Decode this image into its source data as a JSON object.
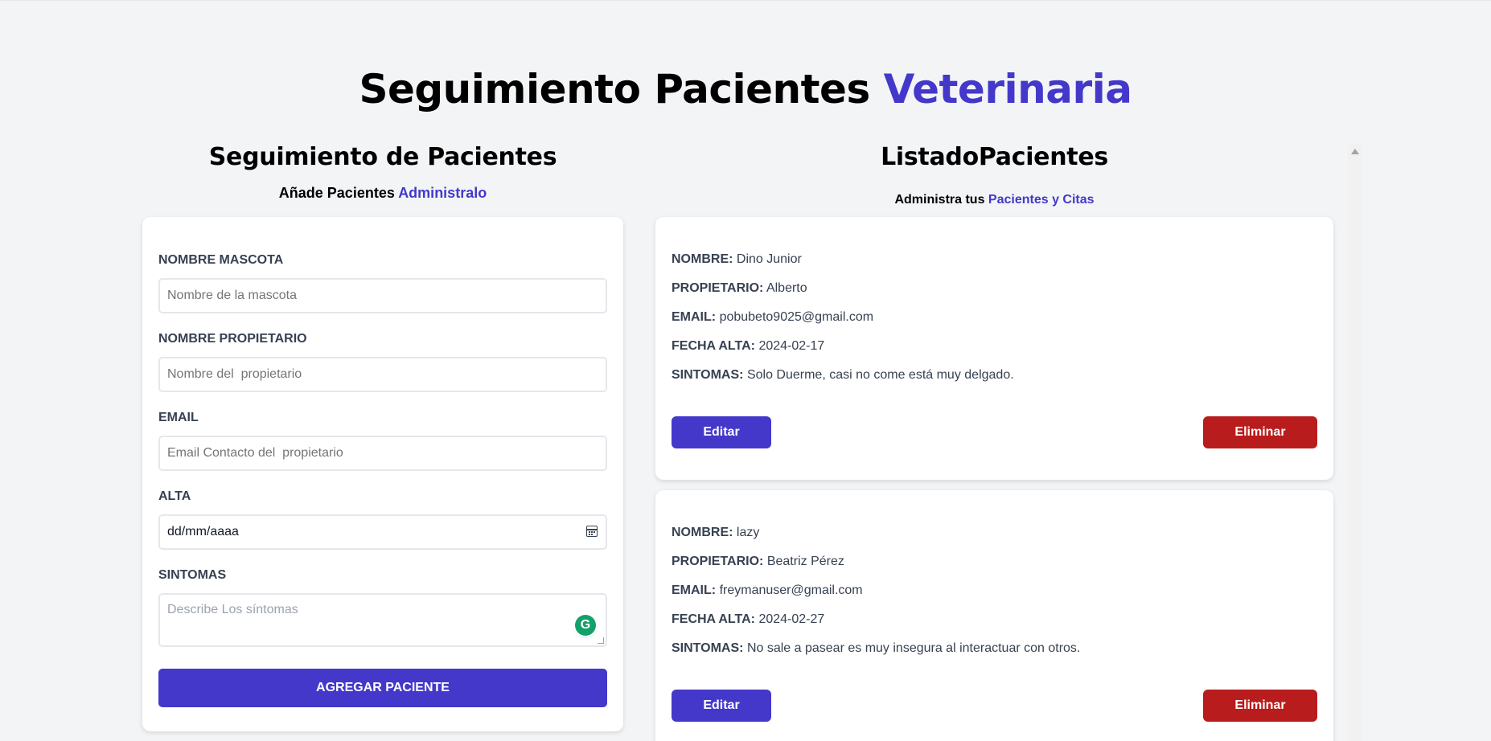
{
  "header": {
    "title_main": "Seguimiento Pacientes",
    "title_accent": "Veterinaria"
  },
  "form_section": {
    "title": "Seguimiento de Pacientes",
    "subtitle_main": "Añade Pacientes",
    "subtitle_accent": "Administralo",
    "fields": {
      "pet_name": {
        "label": "Nombre Mascota",
        "placeholder": "Nombre de la mascota"
      },
      "owner_name": {
        "label": "Nombre Propietario",
        "placeholder": "Nombre del  propietario"
      },
      "email": {
        "label": "Email",
        "placeholder": "Email Contacto del  propietario"
      },
      "discharge": {
        "label": "Alta",
        "value": "dd/mm/aaaa"
      },
      "symptoms": {
        "label": "Sintomas",
        "placeholder": "Describe Los síntomas"
      }
    },
    "submit_label": "Agregar Paciente"
  },
  "list_section": {
    "title": "ListadoPacientes",
    "subtitle_main": "Administra tus",
    "subtitle_accent": "Pacientes y Citas",
    "field_labels": {
      "name": "NOMBRE:",
      "owner": "PROPIETARIO:",
      "email": "EMAIL:",
      "date": "FECHA ALTA:",
      "symptoms": "SINTOMAS:"
    },
    "edit_label": "Editar",
    "delete_label": "Eliminar",
    "patients": [
      {
        "name": "Dino Junior",
        "owner": "Alberto",
        "email": "pobubeto9025@gmail.com",
        "date": "2024-02-17",
        "symptoms": "Solo Duerme, casi no come está muy delgado."
      },
      {
        "name": "lazy",
        "owner": "Beatriz Pérez",
        "email": "freymanuser@gmail.com",
        "date": "2024-02-27",
        "symptoms": "No sale a pasear es muy insegura al interactuar con otros."
      }
    ]
  },
  "colors": {
    "accent": "#4338ca",
    "danger": "#b91c1c",
    "background": "#f3f4f6"
  },
  "icons": {
    "date_picker": "calendar-icon",
    "extension": "grammarly-icon"
  }
}
